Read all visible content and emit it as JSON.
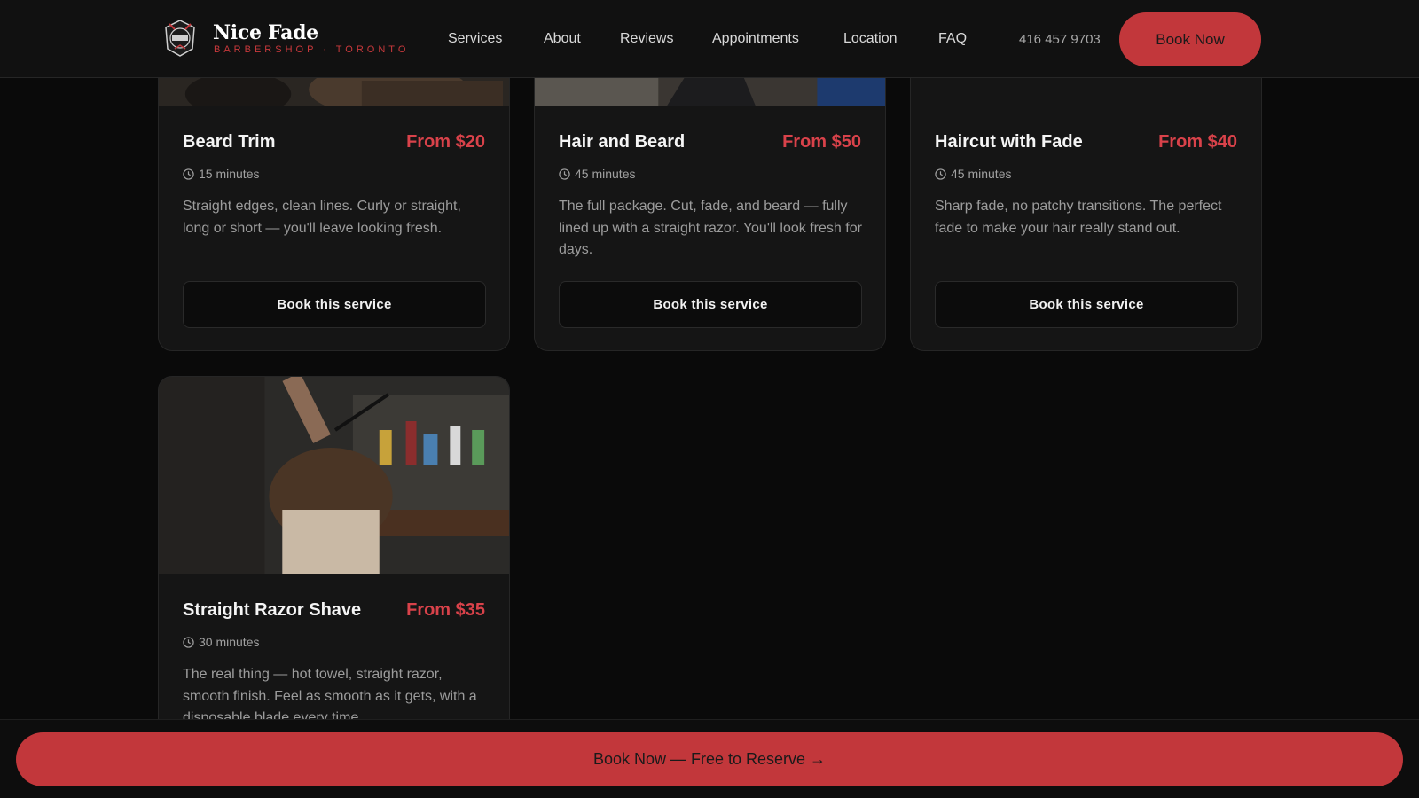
{
  "header": {
    "brand_name": "Nice Fade",
    "brand_sub": "BARBERSHOP · TORONTO",
    "nav": [
      "Services",
      "About",
      "Reviews",
      "Appointments",
      "Location",
      "FAQ"
    ],
    "phone": "416 457 9703",
    "book_now": "Book Now"
  },
  "services": [
    {
      "title": "Beard Trim",
      "price": "From $20",
      "duration": "15 minutes",
      "description": "Straight edges, clean lines. Curly or straight, long or short — you'll leave looking fresh.",
      "button": "Book this service"
    },
    {
      "title": "Hair and Beard",
      "price": "From $50",
      "duration": "45 minutes",
      "description": "The full package. Cut, fade, and beard — fully lined up with a straight razor. You'll look fresh for days.",
      "button": "Book this service"
    },
    {
      "title": "Haircut with Fade",
      "price": "From $40",
      "duration": "45 minutes",
      "description": "Sharp fade, no patchy transitions. The perfect fade to make your hair really stand out.",
      "button": "Book this service"
    },
    {
      "title": "Straight Razor Shave",
      "price": "From $35",
      "duration": "30 minutes",
      "description": "The real thing — hot towel, straight razor, smooth finish. Feel as smooth as it gets, with a disposable blade every time."
    }
  ],
  "bottom_cta": "Book Now — Free to Reserve →",
  "colors": {
    "accent": "#c2373b",
    "price": "#d9424a",
    "background": "#0a0a0a",
    "card": "#151515"
  },
  "icons": {
    "logo": "barber-badge-icon",
    "duration": "clock-icon"
  }
}
